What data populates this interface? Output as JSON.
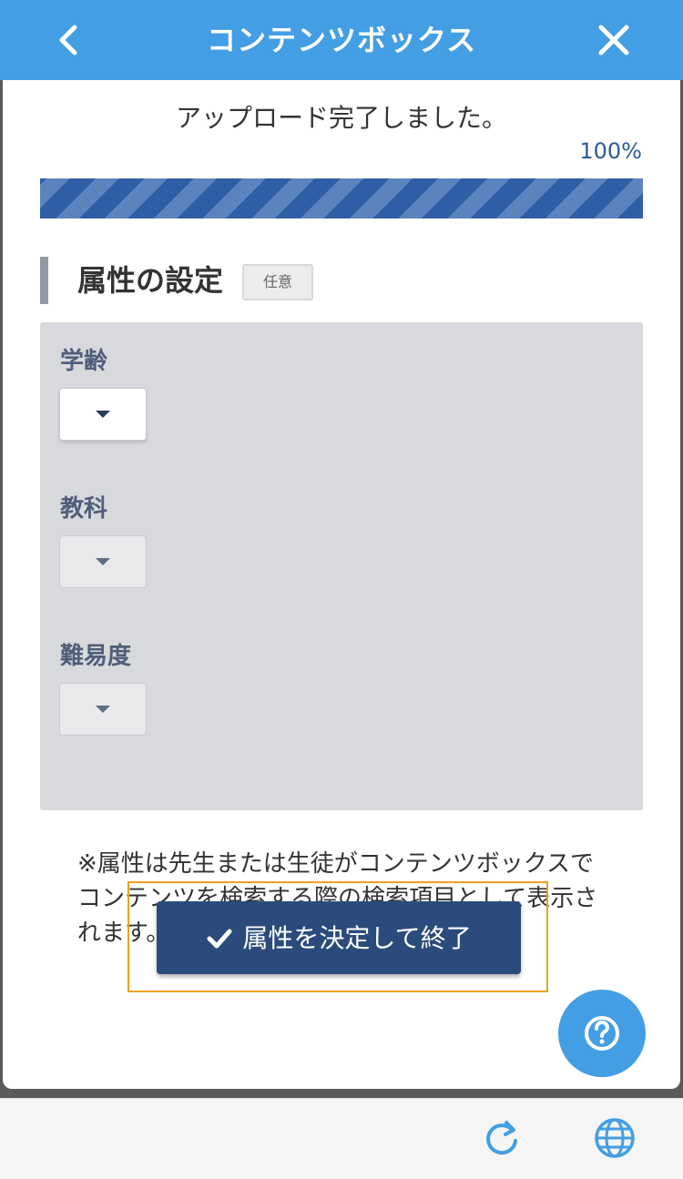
{
  "header": {
    "title": "コンテンツボックス",
    "back_icon": "chevron-left-icon",
    "close_icon": "close-icon"
  },
  "upload": {
    "status": "アップロード完了しました。",
    "percent_label": "100%",
    "progress": 1.0
  },
  "attributes": {
    "title": "属性の設定",
    "badge": "任意",
    "fields": [
      {
        "label": "学齢",
        "value": "",
        "state": "active"
      },
      {
        "label": "教科",
        "value": "",
        "state": "disabled"
      },
      {
        "label": "難易度",
        "value": "",
        "state": "disabled"
      }
    ]
  },
  "note": "※属性は先生または生徒がコンテンツボックスでコンテンツを検索する際の検索項目として表示されます。",
  "confirm_button": {
    "label": "属性を決定して終了",
    "icon": "checkmark-icon"
  },
  "help_button": {
    "icon": "question-icon"
  },
  "toolbar": {
    "refresh_icon": "refresh-icon",
    "globe_icon": "globe-icon"
  },
  "colors": {
    "header": "#439ee3",
    "progress": "#2f5ea6",
    "button": "#2b4b7c",
    "highlight": "#f0a020"
  }
}
